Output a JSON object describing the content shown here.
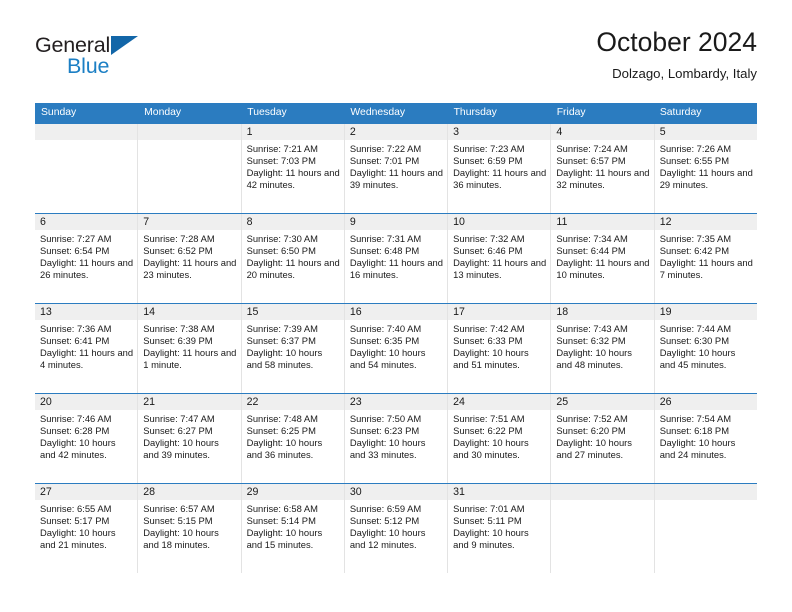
{
  "brand": {
    "name_part1": "General",
    "name_part2": "Blue",
    "accent_color": "#1c7fc4",
    "triangle_color": "#1266a8"
  },
  "header": {
    "month_title": "October 2024",
    "location": "Dolzago, Lombardy, Italy"
  },
  "theme": {
    "header_blue": "#2b7cc0",
    "daynum_band": "#efefef",
    "cell_border": "#e3e3e3",
    "text": "#1a1a1a"
  },
  "weekday_headers": [
    "Sunday",
    "Monday",
    "Tuesday",
    "Wednesday",
    "Thursday",
    "Friday",
    "Saturday"
  ],
  "weeks": [
    [
      {
        "day": "",
        "sunrise": "",
        "sunset": "",
        "daylight": ""
      },
      {
        "day": "",
        "sunrise": "",
        "sunset": "",
        "daylight": ""
      },
      {
        "day": "1",
        "sunrise": "Sunrise: 7:21 AM",
        "sunset": "Sunset: 7:03 PM",
        "daylight": "Daylight: 11 hours and 42 minutes."
      },
      {
        "day": "2",
        "sunrise": "Sunrise: 7:22 AM",
        "sunset": "Sunset: 7:01 PM",
        "daylight": "Daylight: 11 hours and 39 minutes."
      },
      {
        "day": "3",
        "sunrise": "Sunrise: 7:23 AM",
        "sunset": "Sunset: 6:59 PM",
        "daylight": "Daylight: 11 hours and 36 minutes."
      },
      {
        "day": "4",
        "sunrise": "Sunrise: 7:24 AM",
        "sunset": "Sunset: 6:57 PM",
        "daylight": "Daylight: 11 hours and 32 minutes."
      },
      {
        "day": "5",
        "sunrise": "Sunrise: 7:26 AM",
        "sunset": "Sunset: 6:55 PM",
        "daylight": "Daylight: 11 hours and 29 minutes."
      }
    ],
    [
      {
        "day": "6",
        "sunrise": "Sunrise: 7:27 AM",
        "sunset": "Sunset: 6:54 PM",
        "daylight": "Daylight: 11 hours and 26 minutes."
      },
      {
        "day": "7",
        "sunrise": "Sunrise: 7:28 AM",
        "sunset": "Sunset: 6:52 PM",
        "daylight": "Daylight: 11 hours and 23 minutes."
      },
      {
        "day": "8",
        "sunrise": "Sunrise: 7:30 AM",
        "sunset": "Sunset: 6:50 PM",
        "daylight": "Daylight: 11 hours and 20 minutes."
      },
      {
        "day": "9",
        "sunrise": "Sunrise: 7:31 AM",
        "sunset": "Sunset: 6:48 PM",
        "daylight": "Daylight: 11 hours and 16 minutes."
      },
      {
        "day": "10",
        "sunrise": "Sunrise: 7:32 AM",
        "sunset": "Sunset: 6:46 PM",
        "daylight": "Daylight: 11 hours and 13 minutes."
      },
      {
        "day": "11",
        "sunrise": "Sunrise: 7:34 AM",
        "sunset": "Sunset: 6:44 PM",
        "daylight": "Daylight: 11 hours and 10 minutes."
      },
      {
        "day": "12",
        "sunrise": "Sunrise: 7:35 AM",
        "sunset": "Sunset: 6:42 PM",
        "daylight": "Daylight: 11 hours and 7 minutes."
      }
    ],
    [
      {
        "day": "13",
        "sunrise": "Sunrise: 7:36 AM",
        "sunset": "Sunset: 6:41 PM",
        "daylight": "Daylight: 11 hours and 4 minutes."
      },
      {
        "day": "14",
        "sunrise": "Sunrise: 7:38 AM",
        "sunset": "Sunset: 6:39 PM",
        "daylight": "Daylight: 11 hours and 1 minute."
      },
      {
        "day": "15",
        "sunrise": "Sunrise: 7:39 AM",
        "sunset": "Sunset: 6:37 PM",
        "daylight": "Daylight: 10 hours and 58 minutes."
      },
      {
        "day": "16",
        "sunrise": "Sunrise: 7:40 AM",
        "sunset": "Sunset: 6:35 PM",
        "daylight": "Daylight: 10 hours and 54 minutes."
      },
      {
        "day": "17",
        "sunrise": "Sunrise: 7:42 AM",
        "sunset": "Sunset: 6:33 PM",
        "daylight": "Daylight: 10 hours and 51 minutes."
      },
      {
        "day": "18",
        "sunrise": "Sunrise: 7:43 AM",
        "sunset": "Sunset: 6:32 PM",
        "daylight": "Daylight: 10 hours and 48 minutes."
      },
      {
        "day": "19",
        "sunrise": "Sunrise: 7:44 AM",
        "sunset": "Sunset: 6:30 PM",
        "daylight": "Daylight: 10 hours and 45 minutes."
      }
    ],
    [
      {
        "day": "20",
        "sunrise": "Sunrise: 7:46 AM",
        "sunset": "Sunset: 6:28 PM",
        "daylight": "Daylight: 10 hours and 42 minutes."
      },
      {
        "day": "21",
        "sunrise": "Sunrise: 7:47 AM",
        "sunset": "Sunset: 6:27 PM",
        "daylight": "Daylight: 10 hours and 39 minutes."
      },
      {
        "day": "22",
        "sunrise": "Sunrise: 7:48 AM",
        "sunset": "Sunset: 6:25 PM",
        "daylight": "Daylight: 10 hours and 36 minutes."
      },
      {
        "day": "23",
        "sunrise": "Sunrise: 7:50 AM",
        "sunset": "Sunset: 6:23 PM",
        "daylight": "Daylight: 10 hours and 33 minutes."
      },
      {
        "day": "24",
        "sunrise": "Sunrise: 7:51 AM",
        "sunset": "Sunset: 6:22 PM",
        "daylight": "Daylight: 10 hours and 30 minutes."
      },
      {
        "day": "25",
        "sunrise": "Sunrise: 7:52 AM",
        "sunset": "Sunset: 6:20 PM",
        "daylight": "Daylight: 10 hours and 27 minutes."
      },
      {
        "day": "26",
        "sunrise": "Sunrise: 7:54 AM",
        "sunset": "Sunset: 6:18 PM",
        "daylight": "Daylight: 10 hours and 24 minutes."
      }
    ],
    [
      {
        "day": "27",
        "sunrise": "Sunrise: 6:55 AM",
        "sunset": "Sunset: 5:17 PM",
        "daylight": "Daylight: 10 hours and 21 minutes."
      },
      {
        "day": "28",
        "sunrise": "Sunrise: 6:57 AM",
        "sunset": "Sunset: 5:15 PM",
        "daylight": "Daylight: 10 hours and 18 minutes."
      },
      {
        "day": "29",
        "sunrise": "Sunrise: 6:58 AM",
        "sunset": "Sunset: 5:14 PM",
        "daylight": "Daylight: 10 hours and 15 minutes."
      },
      {
        "day": "30",
        "sunrise": "Sunrise: 6:59 AM",
        "sunset": "Sunset: 5:12 PM",
        "daylight": "Daylight: 10 hours and 12 minutes."
      },
      {
        "day": "31",
        "sunrise": "Sunrise: 7:01 AM",
        "sunset": "Sunset: 5:11 PM",
        "daylight": "Daylight: 10 hours and 9 minutes."
      },
      {
        "day": "",
        "sunrise": "",
        "sunset": "",
        "daylight": ""
      },
      {
        "day": "",
        "sunrise": "",
        "sunset": "",
        "daylight": ""
      }
    ]
  ]
}
